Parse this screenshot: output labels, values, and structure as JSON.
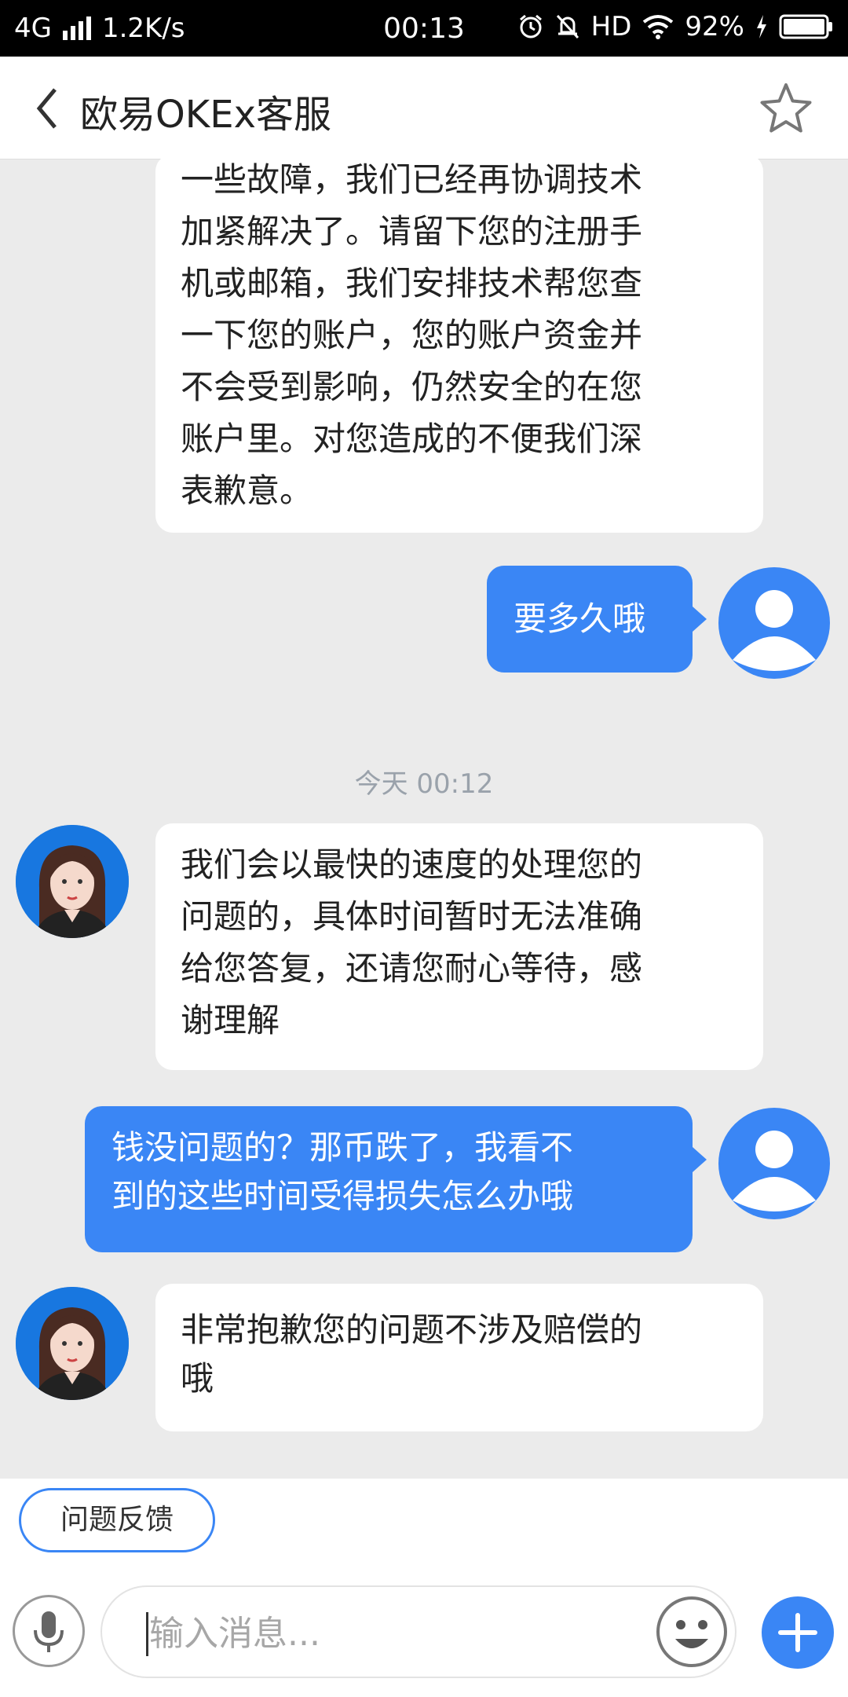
{
  "status_bar": {
    "network": "4G",
    "speed": "1.2K/s",
    "time": "00:13",
    "hd_label": "HD",
    "battery": "92%"
  },
  "header": {
    "title": "欧易OKEx客服",
    "back_icon": "chevron-left-icon",
    "star_icon": "star-outline-icon"
  },
  "messages": [
    {
      "from": "agent",
      "lines": [
        "一些故障，我们已经再协调技术",
        "加紧解决了。请留下您的注册手",
        "机或邮箱，我们安排技术帮您查",
        "一下您的账户，您的账户资金并",
        "不会受到影响，仍然安全的在您",
        "账户里。对您造成的不便我们深",
        "表歉意。"
      ]
    },
    {
      "from": "user",
      "lines": [
        "要多久哦"
      ]
    },
    {
      "timestamp": "今天 00:12"
    },
    {
      "from": "agent",
      "lines": [
        "我们会以最快的速度的处理您的",
        "问题的，具体时间暂时无法准确",
        "给您答复，还请您耐心等待，感",
        "谢理解"
      ]
    },
    {
      "from": "user",
      "lines": [
        "钱没问题的？那币跌了，我看不",
        "到的这些时间受得损失怎么办哦"
      ]
    },
    {
      "from": "agent",
      "lines": [
        "非常抱歉您的问题不涉及赔偿的",
        "哦"
      ]
    }
  ],
  "quick_reply": "问题反馈",
  "input": {
    "placeholder": "输入消息..."
  },
  "colors": {
    "accent": "#3a86f5",
    "background": "#ebebeb"
  }
}
